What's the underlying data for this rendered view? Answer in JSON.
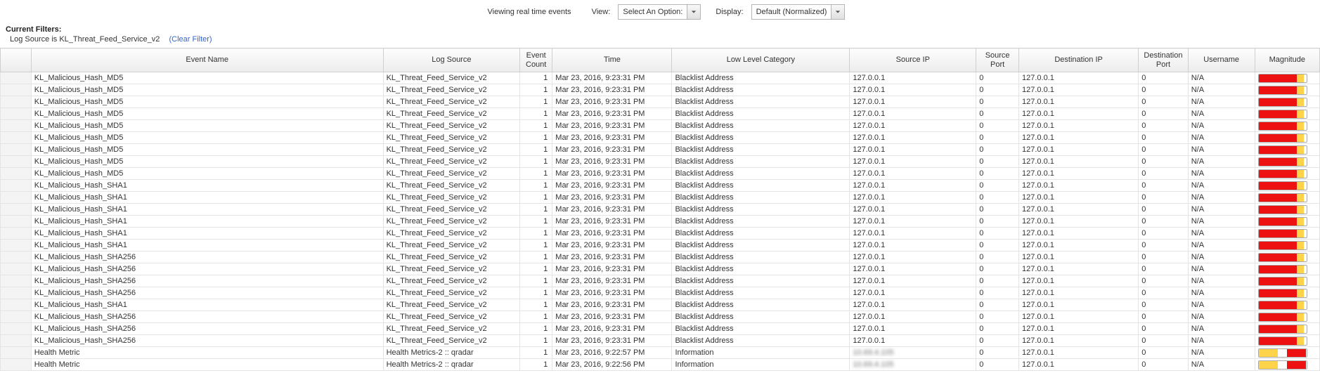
{
  "top": {
    "status": "Viewing real time events",
    "view_label": "View:",
    "view_value": "Select An Option:",
    "display_label": "Display:",
    "display_value": "Default (Normalized)"
  },
  "filters": {
    "header": "Current Filters:",
    "text": "Log Source is KL_Threat_Feed_Service_v2",
    "clear": "(Clear Filter)"
  },
  "columns": [
    "Event Name",
    "Log Source",
    "Event Count",
    "Time",
    "Low Level Category",
    "Source IP",
    "Source Port",
    "Destination IP",
    "Destination Port",
    "Username",
    "Magnitude"
  ],
  "rows": [
    {
      "event": "KL_Malicious_Hash_MD5",
      "log": "KL_Threat_Feed_Service_v2",
      "count": 1,
      "time": "Mar 23, 2016, 9:23:31 PM",
      "cat": "Blacklist Address",
      "sip": "127.0.0.1",
      "sport": 0,
      "dip": "127.0.0.1",
      "dport": 0,
      "user": "N/A",
      "mag": [
        80,
        15,
        5
      ]
    },
    {
      "event": "KL_Malicious_Hash_MD5",
      "log": "KL_Threat_Feed_Service_v2",
      "count": 1,
      "time": "Mar 23, 2016, 9:23:31 PM",
      "cat": "Blacklist Address",
      "sip": "127.0.0.1",
      "sport": 0,
      "dip": "127.0.0.1",
      "dport": 0,
      "user": "N/A",
      "mag": [
        80,
        15,
        5
      ]
    },
    {
      "event": "KL_Malicious_Hash_MD5",
      "log": "KL_Threat_Feed_Service_v2",
      "count": 1,
      "time": "Mar 23, 2016, 9:23:31 PM",
      "cat": "Blacklist Address",
      "sip": "127.0.0.1",
      "sport": 0,
      "dip": "127.0.0.1",
      "dport": 0,
      "user": "N/A",
      "mag": [
        80,
        15,
        5
      ]
    },
    {
      "event": "KL_Malicious_Hash_MD5",
      "log": "KL_Threat_Feed_Service_v2",
      "count": 1,
      "time": "Mar 23, 2016, 9:23:31 PM",
      "cat": "Blacklist Address",
      "sip": "127.0.0.1",
      "sport": 0,
      "dip": "127.0.0.1",
      "dport": 0,
      "user": "N/A",
      "mag": [
        80,
        15,
        5
      ]
    },
    {
      "event": "KL_Malicious_Hash_MD5",
      "log": "KL_Threat_Feed_Service_v2",
      "count": 1,
      "time": "Mar 23, 2016, 9:23:31 PM",
      "cat": "Blacklist Address",
      "sip": "127.0.0.1",
      "sport": 0,
      "dip": "127.0.0.1",
      "dport": 0,
      "user": "N/A",
      "mag": [
        80,
        15,
        5
      ]
    },
    {
      "event": "KL_Malicious_Hash_MD5",
      "log": "KL_Threat_Feed_Service_v2",
      "count": 1,
      "time": "Mar 23, 2016, 9:23:31 PM",
      "cat": "Blacklist Address",
      "sip": "127.0.0.1",
      "sport": 0,
      "dip": "127.0.0.1",
      "dport": 0,
      "user": "N/A",
      "mag": [
        80,
        15,
        5
      ]
    },
    {
      "event": "KL_Malicious_Hash_MD5",
      "log": "KL_Threat_Feed_Service_v2",
      "count": 1,
      "time": "Mar 23, 2016, 9:23:31 PM",
      "cat": "Blacklist Address",
      "sip": "127.0.0.1",
      "sport": 0,
      "dip": "127.0.0.1",
      "dport": 0,
      "user": "N/A",
      "mag": [
        80,
        15,
        5
      ]
    },
    {
      "event": "KL_Malicious_Hash_MD5",
      "log": "KL_Threat_Feed_Service_v2",
      "count": 1,
      "time": "Mar 23, 2016, 9:23:31 PM",
      "cat": "Blacklist Address",
      "sip": "127.0.0.1",
      "sport": 0,
      "dip": "127.0.0.1",
      "dport": 0,
      "user": "N/A",
      "mag": [
        80,
        15,
        5
      ]
    },
    {
      "event": "KL_Malicious_Hash_MD5",
      "log": "KL_Threat_Feed_Service_v2",
      "count": 1,
      "time": "Mar 23, 2016, 9:23:31 PM",
      "cat": "Blacklist Address",
      "sip": "127.0.0.1",
      "sport": 0,
      "dip": "127.0.0.1",
      "dport": 0,
      "user": "N/A",
      "mag": [
        80,
        15,
        5
      ]
    },
    {
      "event": "KL_Malicious_Hash_SHA1",
      "log": "KL_Threat_Feed_Service_v2",
      "count": 1,
      "time": "Mar 23, 2016, 9:23:31 PM",
      "cat": "Blacklist Address",
      "sip": "127.0.0.1",
      "sport": 0,
      "dip": "127.0.0.1",
      "dport": 0,
      "user": "N/A",
      "mag": [
        80,
        15,
        5
      ]
    },
    {
      "event": "KL_Malicious_Hash_SHA1",
      "log": "KL_Threat_Feed_Service_v2",
      "count": 1,
      "time": "Mar 23, 2016, 9:23:31 PM",
      "cat": "Blacklist Address",
      "sip": "127.0.0.1",
      "sport": 0,
      "dip": "127.0.0.1",
      "dport": 0,
      "user": "N/A",
      "mag": [
        80,
        15,
        5
      ]
    },
    {
      "event": "KL_Malicious_Hash_SHA1",
      "log": "KL_Threat_Feed_Service_v2",
      "count": 1,
      "time": "Mar 23, 2016, 9:23:31 PM",
      "cat": "Blacklist Address",
      "sip": "127.0.0.1",
      "sport": 0,
      "dip": "127.0.0.1",
      "dport": 0,
      "user": "N/A",
      "mag": [
        80,
        15,
        5
      ]
    },
    {
      "event": "KL_Malicious_Hash_SHA1",
      "log": "KL_Threat_Feed_Service_v2",
      "count": 1,
      "time": "Mar 23, 2016, 9:23:31 PM",
      "cat": "Blacklist Address",
      "sip": "127.0.0.1",
      "sport": 0,
      "dip": "127.0.0.1",
      "dport": 0,
      "user": "N/A",
      "mag": [
        80,
        15,
        5
      ]
    },
    {
      "event": "KL_Malicious_Hash_SHA1",
      "log": "KL_Threat_Feed_Service_v2",
      "count": 1,
      "time": "Mar 23, 2016, 9:23:31 PM",
      "cat": "Blacklist Address",
      "sip": "127.0.0.1",
      "sport": 0,
      "dip": "127.0.0.1",
      "dport": 0,
      "user": "N/A",
      "mag": [
        80,
        15,
        5
      ]
    },
    {
      "event": "KL_Malicious_Hash_SHA1",
      "log": "KL_Threat_Feed_Service_v2",
      "count": 1,
      "time": "Mar 23, 2016, 9:23:31 PM",
      "cat": "Blacklist Address",
      "sip": "127.0.0.1",
      "sport": 0,
      "dip": "127.0.0.1",
      "dport": 0,
      "user": "N/A",
      "mag": [
        80,
        15,
        5
      ]
    },
    {
      "event": "KL_Malicious_Hash_SHA256",
      "log": "KL_Threat_Feed_Service_v2",
      "count": 1,
      "time": "Mar 23, 2016, 9:23:31 PM",
      "cat": "Blacklist Address",
      "sip": "127.0.0.1",
      "sport": 0,
      "dip": "127.0.0.1",
      "dport": 0,
      "user": "N/A",
      "mag": [
        80,
        15,
        5
      ]
    },
    {
      "event": "KL_Malicious_Hash_SHA256",
      "log": "KL_Threat_Feed_Service_v2",
      "count": 1,
      "time": "Mar 23, 2016, 9:23:31 PM",
      "cat": "Blacklist Address",
      "sip": "127.0.0.1",
      "sport": 0,
      "dip": "127.0.0.1",
      "dport": 0,
      "user": "N/A",
      "mag": [
        80,
        15,
        5
      ]
    },
    {
      "event": "KL_Malicious_Hash_SHA256",
      "log": "KL_Threat_Feed_Service_v2",
      "count": 1,
      "time": "Mar 23, 2016, 9:23:31 PM",
      "cat": "Blacklist Address",
      "sip": "127.0.0.1",
      "sport": 0,
      "dip": "127.0.0.1",
      "dport": 0,
      "user": "N/A",
      "mag": [
        80,
        15,
        5
      ]
    },
    {
      "event": "KL_Malicious_Hash_SHA256",
      "log": "KL_Threat_Feed_Service_v2",
      "count": 1,
      "time": "Mar 23, 2016, 9:23:31 PM",
      "cat": "Blacklist Address",
      "sip": "127.0.0.1",
      "sport": 0,
      "dip": "127.0.0.1",
      "dport": 0,
      "user": "N/A",
      "mag": [
        80,
        15,
        5
      ]
    },
    {
      "event": "KL_Malicious_Hash_SHA1",
      "log": "KL_Threat_Feed_Service_v2",
      "count": 1,
      "time": "Mar 23, 2016, 9:23:31 PM",
      "cat": "Blacklist Address",
      "sip": "127.0.0.1",
      "sport": 0,
      "dip": "127.0.0.1",
      "dport": 0,
      "user": "N/A",
      "mag": [
        80,
        15,
        5
      ]
    },
    {
      "event": "KL_Malicious_Hash_SHA256",
      "log": "KL_Threat_Feed_Service_v2",
      "count": 1,
      "time": "Mar 23, 2016, 9:23:31 PM",
      "cat": "Blacklist Address",
      "sip": "127.0.0.1",
      "sport": 0,
      "dip": "127.0.0.1",
      "dport": 0,
      "user": "N/A",
      "mag": [
        80,
        15,
        5
      ]
    },
    {
      "event": "KL_Malicious_Hash_SHA256",
      "log": "KL_Threat_Feed_Service_v2",
      "count": 1,
      "time": "Mar 23, 2016, 9:23:31 PM",
      "cat": "Blacklist Address",
      "sip": "127.0.0.1",
      "sport": 0,
      "dip": "127.0.0.1",
      "dport": 0,
      "user": "N/A",
      "mag": [
        80,
        15,
        5
      ]
    },
    {
      "event": "KL_Malicious_Hash_SHA256",
      "log": "KL_Threat_Feed_Service_v2",
      "count": 1,
      "time": "Mar 23, 2016, 9:23:31 PM",
      "cat": "Blacklist Address",
      "sip": "127.0.0.1",
      "sport": 0,
      "dip": "127.0.0.1",
      "dport": 0,
      "user": "N/A",
      "mag": [
        80,
        15,
        5
      ]
    },
    {
      "event": "Health Metric",
      "log": "Health Metrics-2 :: qradar",
      "count": 1,
      "time": "Mar 23, 2016, 9:22:57 PM",
      "cat": "Information",
      "sip": "10.69.4.105",
      "sip_blur": true,
      "sport": 0,
      "dip": "127.0.0.1",
      "dport": 0,
      "user": "N/A",
      "mag": [
        0,
        40,
        60
      ],
      "mag_style": "yel-first"
    },
    {
      "event": "Health Metric",
      "log": "Health Metrics-2 :: qradar",
      "count": 1,
      "time": "Mar 23, 2016, 9:22:56 PM",
      "cat": "Information",
      "sip": "10.69.4.105",
      "sip_blur": true,
      "sport": 0,
      "dip": "127.0.0.1",
      "dport": 0,
      "user": "N/A",
      "mag": [
        0,
        40,
        60
      ],
      "mag_style": "yel-first"
    }
  ]
}
